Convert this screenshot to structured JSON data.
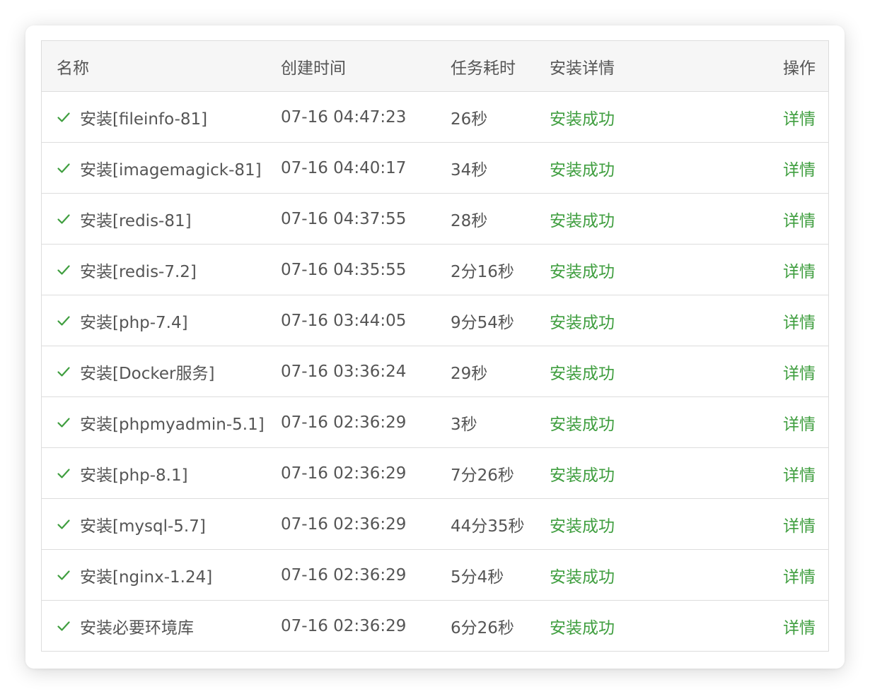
{
  "table": {
    "headers": {
      "name": "名称",
      "created": "创建时间",
      "duration": "任务耗时",
      "detail": "安装详情",
      "action": "操作"
    },
    "rows": [
      {
        "name": "安装[fileinfo-81]",
        "created": "07-16 04:47:23",
        "duration": "26秒",
        "status": "安装成功",
        "action": "详情"
      },
      {
        "name": "安装[imagemagick-81]",
        "created": "07-16 04:40:17",
        "duration": "34秒",
        "status": "安装成功",
        "action": "详情"
      },
      {
        "name": "安装[redis-81]",
        "created": "07-16 04:37:55",
        "duration": "28秒",
        "status": "安装成功",
        "action": "详情"
      },
      {
        "name": "安装[redis-7.2]",
        "created": "07-16 04:35:55",
        "duration": "2分16秒",
        "status": "安装成功",
        "action": "详情"
      },
      {
        "name": "安装[php-7.4]",
        "created": "07-16 03:44:05",
        "duration": "9分54秒",
        "status": "安装成功",
        "action": "详情"
      },
      {
        "name": "安装[Docker服务]",
        "created": "07-16 03:36:24",
        "duration": "29秒",
        "status": "安装成功",
        "action": "详情"
      },
      {
        "name": "安装[phpmyadmin-5.1]",
        "created": "07-16 02:36:29",
        "duration": "3秒",
        "status": "安装成功",
        "action": "详情"
      },
      {
        "name": "安装[php-8.1]",
        "created": "07-16 02:36:29",
        "duration": "7分26秒",
        "status": "安装成功",
        "action": "详情"
      },
      {
        "name": "安装[mysql-5.7]",
        "created": "07-16 02:36:29",
        "duration": "44分35秒",
        "status": "安装成功",
        "action": "详情"
      },
      {
        "name": "安装[nginx-1.24]",
        "created": "07-16 02:36:29",
        "duration": "5分4秒",
        "status": "安装成功",
        "action": "详情"
      },
      {
        "name": "安装必要环境库",
        "created": "07-16 02:36:29",
        "duration": "6分26秒",
        "status": "安装成功",
        "action": "详情"
      }
    ]
  },
  "colors": {
    "success": "#3f9e3f",
    "text": "#555555",
    "header_bg": "#f6f6f6",
    "border": "#dddddd"
  },
  "icons": {
    "row_status": "check-icon"
  }
}
